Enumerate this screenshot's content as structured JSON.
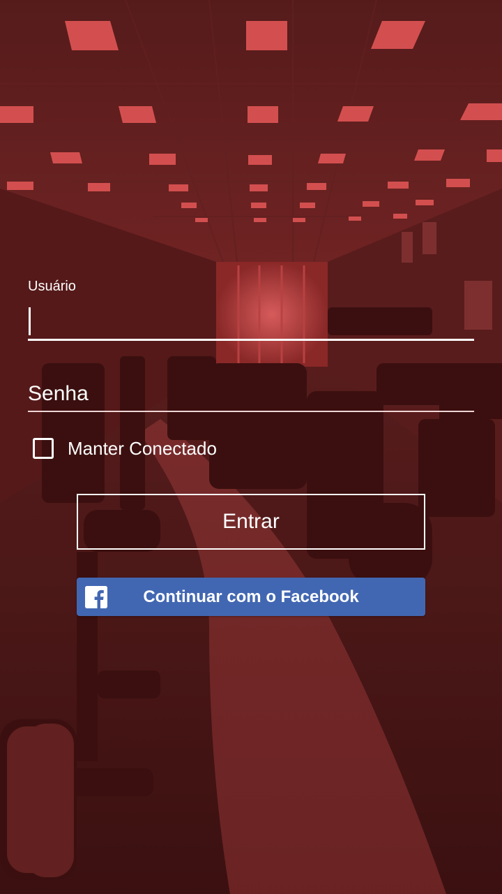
{
  "login": {
    "username_label": "Usuário",
    "username_value": "",
    "password_placeholder": "Senha",
    "remember_label": "Manter Conectado",
    "remember_checked": false,
    "submit_label": "Entrar",
    "facebook_label": "Continuar com o Facebook"
  },
  "theme": {
    "overlay_color": "#8b2020",
    "facebook_blue": "#4267b2",
    "text_color": "#ffffff"
  },
  "icons": {
    "facebook": "facebook-icon"
  }
}
